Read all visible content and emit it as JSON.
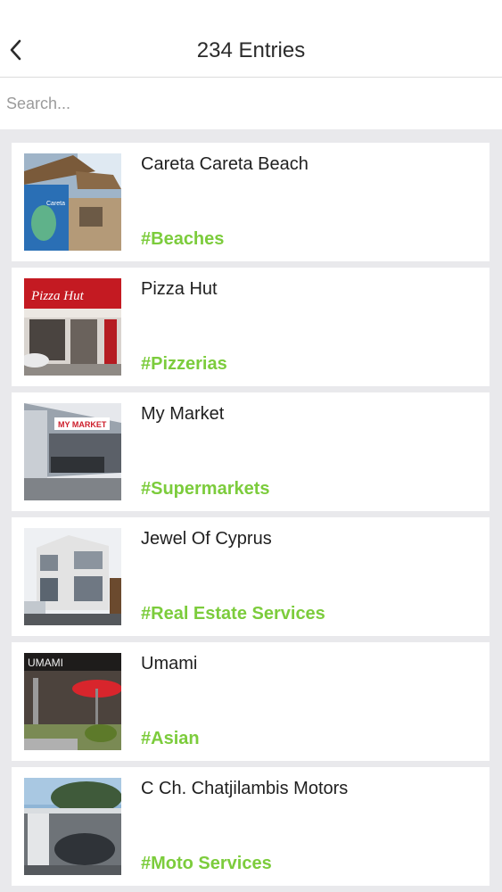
{
  "header": {
    "title": "234 Entries",
    "back_icon": "chevron-left-icon"
  },
  "search": {
    "placeholder": "Search...",
    "value": ""
  },
  "colors": {
    "tag": "#7ccc3c",
    "background": "#e9e9ec"
  },
  "entries": [
    {
      "name": "Careta Careta Beach",
      "tag": "#Beaches",
      "thumb_text": "Careta"
    },
    {
      "name": "Pizza Hut",
      "tag": "#Pizzerias",
      "thumb_text": "Pizza Hut"
    },
    {
      "name": "My Market",
      "tag": "#Supermarkets",
      "thumb_text": "MY MARKET"
    },
    {
      "name": "Jewel Of Cyprus",
      "tag": "#Real Estate Services"
    },
    {
      "name": "Umami",
      "tag": "#Asian",
      "thumb_text": "UMAMI"
    },
    {
      "name": "C Ch. Chatjilambis Motors",
      "tag": "#Moto Services"
    }
  ]
}
